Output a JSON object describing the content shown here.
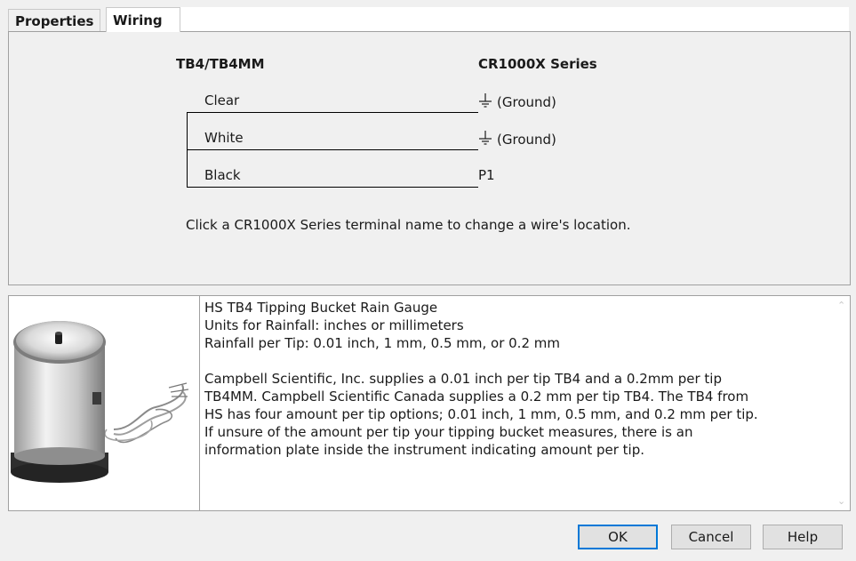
{
  "tabs": [
    {
      "label": "Properties"
    },
    {
      "label": "Wiring"
    }
  ],
  "wiring": {
    "sensor_header": "TB4/TB4MM",
    "logger_header": "CR1000X Series",
    "rows": [
      {
        "wire": "Clear",
        "terminal": "(Ground)",
        "icon": "ground-icon"
      },
      {
        "wire": "White",
        "terminal": "(Ground)",
        "icon": "ground-icon"
      },
      {
        "wire": "Black",
        "terminal": "P1"
      }
    ],
    "hint": "Click a CR1000X Series terminal name to change a wire's location."
  },
  "description": {
    "text": "HS TB4 Tipping Bucket Rain Gauge\nUnits for Rainfall: inches or millimeters\nRainfall per Tip: 0.01 inch, 1 mm, 0.5 mm, or 0.2 mm\n\nCampbell Scientific, Inc. supplies a 0.01 inch per tip TB4 and a 0.2mm per tip\nTB4MM. Campbell Scientific Canada supplies a 0.2 mm per tip TB4. The TB4 from\nHS has four amount per tip options; 0.01 inch, 1 mm, 0.5 mm, and 0.2 mm per tip.\nIf unsure of the amount per tip your tipping bucket measures, there is an\ninformation plate inside the instrument indicating amount per tip."
  },
  "buttons": {
    "ok": "OK",
    "cancel": "Cancel",
    "help": "Help"
  },
  "colors": {
    "accent": "#0078d7",
    "background": "#f0f0f0"
  }
}
